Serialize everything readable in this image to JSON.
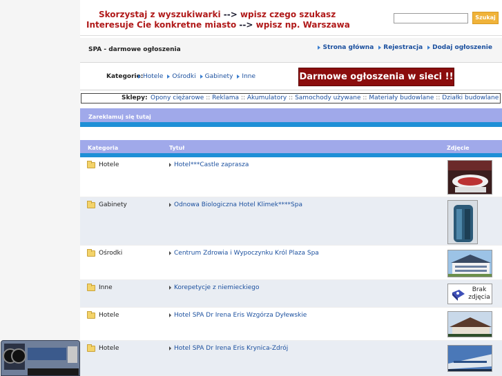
{
  "banner": {
    "line1_part1": "Skorzystaj z wyszukiwarki",
    "line1_arrow": "-->",
    "line1_part2": "wpisz czego szukasz",
    "line2_part1": "Interesuje Cie konkretne miasto",
    "line2_arrow": "-->",
    "line2_part2": "wpisz np. Warszawa"
  },
  "search": {
    "value": "",
    "placeholder": "",
    "button_label": "Szukaj"
  },
  "nav": {
    "site_name": "SPA - darmowe ogłoszenia",
    "links": [
      "Strona główna",
      "Rejestracja",
      "Dodaj ogłoszenie"
    ]
  },
  "categories": {
    "label": "Kategorie:",
    "items": [
      "Hotele",
      "Ośrodki",
      "Gabinety",
      "Inne"
    ],
    "promo": "Darmowe ogłoszenia w sieci !!"
  },
  "shops": {
    "label": "Sklepy:",
    "links": [
      "Opony ciężarowe",
      "Reklama",
      "Akumulatory",
      "Samochody używane",
      "Materiały budowlane",
      "Działki budowlane"
    ],
    "separator": "::"
  },
  "advert": {
    "heading": "Zareklamuj się tutaj"
  },
  "listing": {
    "columns": [
      "Kategoria",
      "Tytuł",
      "Zdjęcie"
    ],
    "rows": [
      {
        "category": "Hotele",
        "title": "Hotel***Castle zaprasza",
        "image": "banquet-hall"
      },
      {
        "category": "Gabinety",
        "title": "Odnowa Biologiczna Hotel Klimek****Spa",
        "image": "spa-cabin"
      },
      {
        "category": "Ośrodki",
        "title": "Centrum Zdrowia i Wypoczynku Król Plaza Spa",
        "image": "hotel-building"
      },
      {
        "category": "Inne",
        "title": "Korepetycje z niemieckiego",
        "image": "no-photo",
        "no_photo_text": "Brak zdjęcia"
      },
      {
        "category": "Hotele",
        "title": "Hotel SPA Dr Irena Eris Wzgórza Dyłewskie",
        "image": "hotel-roof"
      },
      {
        "category": "Hotele",
        "title": "Hotel SPA Dr Irena Eris Krynica-Zdrój",
        "image": "hotel-modern"
      }
    ]
  },
  "colors": {
    "header_bar": "#a0a9ea",
    "stripe": "#1e8fd6",
    "link": "#1a4f9e",
    "banner_red": "#b01a1a",
    "search_button": "#f0b33a",
    "promo_bg": "#8b0d0d"
  }
}
